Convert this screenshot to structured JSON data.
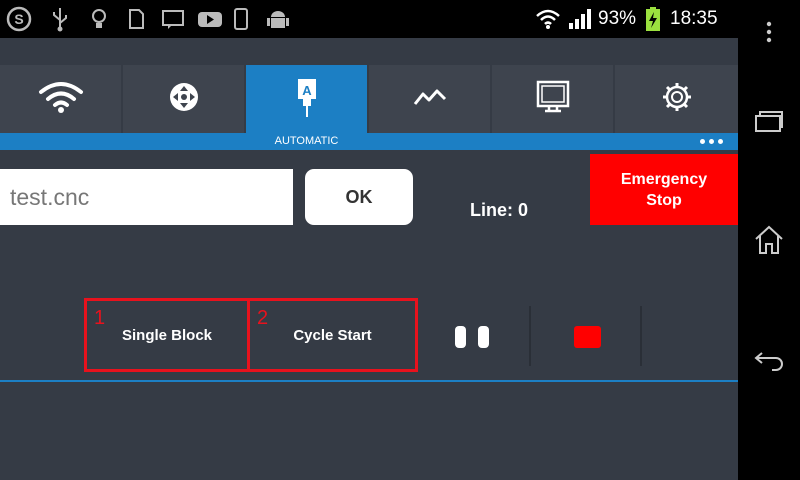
{
  "status_bar": {
    "left_icons": [
      "skype-icon",
      "usb-icon",
      "lightbulb-icon",
      "sd-card-icon",
      "chat-icon",
      "youtube-icon",
      "phone-icon",
      "android-icon"
    ],
    "battery_percent": "93%",
    "time": "18:35"
  },
  "tabs": [
    {
      "icon": "wifi-icon",
      "active": false
    },
    {
      "icon": "move-arrows-icon",
      "active": false
    },
    {
      "icon": "automatic-icon",
      "active": true,
      "label": "AUTOMATIC"
    },
    {
      "icon": "chart-icon",
      "active": false
    },
    {
      "icon": "monitor-icon",
      "active": false
    },
    {
      "icon": "gear-icon",
      "active": false
    }
  ],
  "file": {
    "value": "test.cnc"
  },
  "ok_label": "OK",
  "line_info": "Line: 0",
  "emergency": {
    "line1": "Emergency",
    "line2": "Stop"
  },
  "controls": [
    {
      "num": "1",
      "label": "Single Block"
    },
    {
      "num": "2",
      "label": "Cycle Start"
    }
  ],
  "colors": {
    "accent": "#1c7fc4",
    "background": "#353b45",
    "tab": "#3e444e",
    "danger": "#ff0000",
    "highlight_box": "#e8121d"
  }
}
